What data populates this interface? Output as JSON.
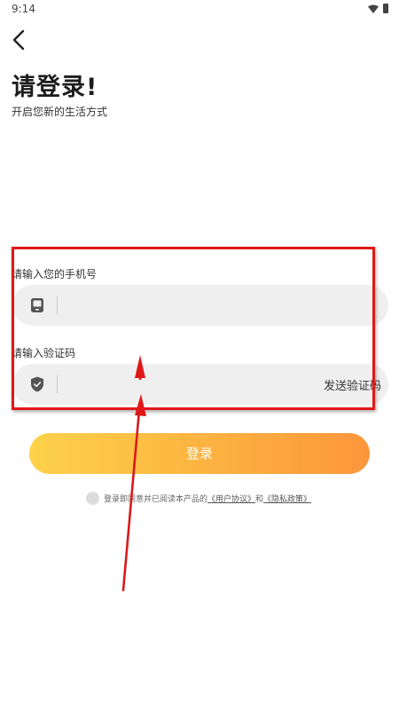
{
  "status_bar": {
    "time": "9:14",
    "wifi_icon": "wifi-icon",
    "battery_icon": "battery-icon"
  },
  "nav": {
    "back_icon": "chevron-left-icon"
  },
  "header": {
    "title": "请登录!",
    "subtitle": "开启您新的生活方式"
  },
  "form": {
    "phone": {
      "label": "请输入您的手机号",
      "value": "",
      "icon": "phone-icon"
    },
    "code": {
      "label": "请输入验证码",
      "value": "",
      "icon": "shield-check-icon",
      "send_label": "发送验证码"
    }
  },
  "login_button": {
    "label": "登录"
  },
  "agreement": {
    "text": "登录即同意并已阅读本产品的",
    "user_agreement": "《用户协议》",
    "and": "和",
    "privacy_policy": "《隐私政策》",
    "checked": false
  },
  "colors": {
    "gradient_start": "#fdd24a",
    "gradient_end": "#fd963b",
    "field_bg": "#efefef",
    "annotation_red": "#e01818"
  }
}
